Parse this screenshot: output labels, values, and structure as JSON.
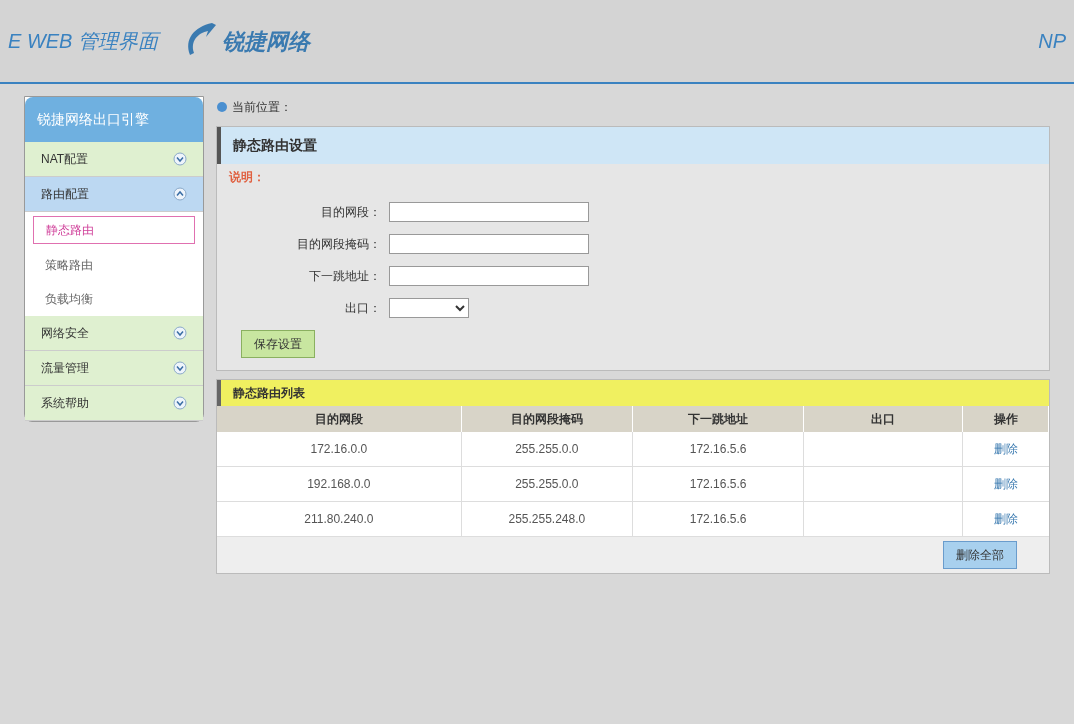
{
  "header": {
    "title": "E WEB 管理界面",
    "brand": "锐捷网络",
    "right_text": "NP"
  },
  "sidebar": {
    "title": "锐捷网络出口引擎",
    "items": [
      {
        "label": "NAT配置",
        "expanded": false
      },
      {
        "label": "路由配置",
        "expanded": true,
        "children": [
          {
            "label": "静态路由",
            "selected": true
          },
          {
            "label": "策略路由",
            "selected": false
          },
          {
            "label": "负载均衡",
            "selected": false
          }
        ]
      },
      {
        "label": "网络安全",
        "expanded": false
      },
      {
        "label": "流量管理",
        "expanded": false
      },
      {
        "label": "系统帮助",
        "expanded": false
      }
    ]
  },
  "breadcrumb": "当前位置：",
  "settings": {
    "title": "静态路由设置",
    "note_label": "说明：",
    "fields": [
      {
        "label": "目的网段："
      },
      {
        "label": "目的网段掩码："
      },
      {
        "label": "下一跳地址："
      }
    ],
    "exit_label": "出口：",
    "save": "保存设置"
  },
  "list": {
    "title": "静态路由列表",
    "columns": [
      "目的网段",
      "目的网段掩码",
      "下一跳地址",
      "出口",
      "操作"
    ],
    "rows": [
      {
        "network": "172.16.0.0",
        "mask": "255.255.0.0",
        "next_hop": "172.16.5.6",
        "action": "删除"
      },
      {
        "network": "192.168.0.0",
        "mask": "255.255.0.0",
        "next_hop": "172.16.5.6",
        "action": "删除"
      },
      {
        "network": "211.80.240.0",
        "mask": "255.255.248.0",
        "next_hop": "172.16.5.6",
        "action": "删除"
      }
    ],
    "delete_all": "删除全部"
  }
}
